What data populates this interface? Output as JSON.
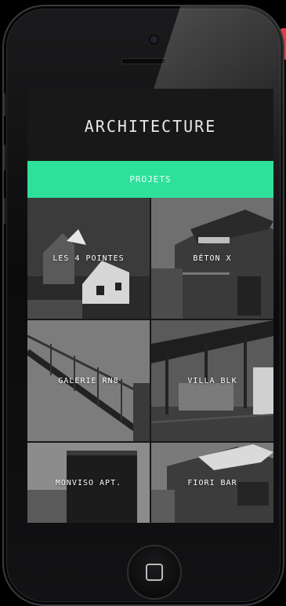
{
  "app": {
    "title": "ARCHITECTURE",
    "tab_label": "PROJETS"
  },
  "projects": [
    {
      "label": "LES 4 POINTES"
    },
    {
      "label": "BÉTON X"
    },
    {
      "label": "GALERIE RN8"
    },
    {
      "label": "VILLA BLK"
    },
    {
      "label": "MONVISO APT."
    },
    {
      "label": "FIORI BAR"
    }
  ],
  "colors": {
    "accent": "#2ee19b",
    "screen_bg": "#181818",
    "device": "#0b0b0c"
  },
  "icons": {
    "home": "home-button-icon",
    "camera": "front-camera-icon"
  }
}
